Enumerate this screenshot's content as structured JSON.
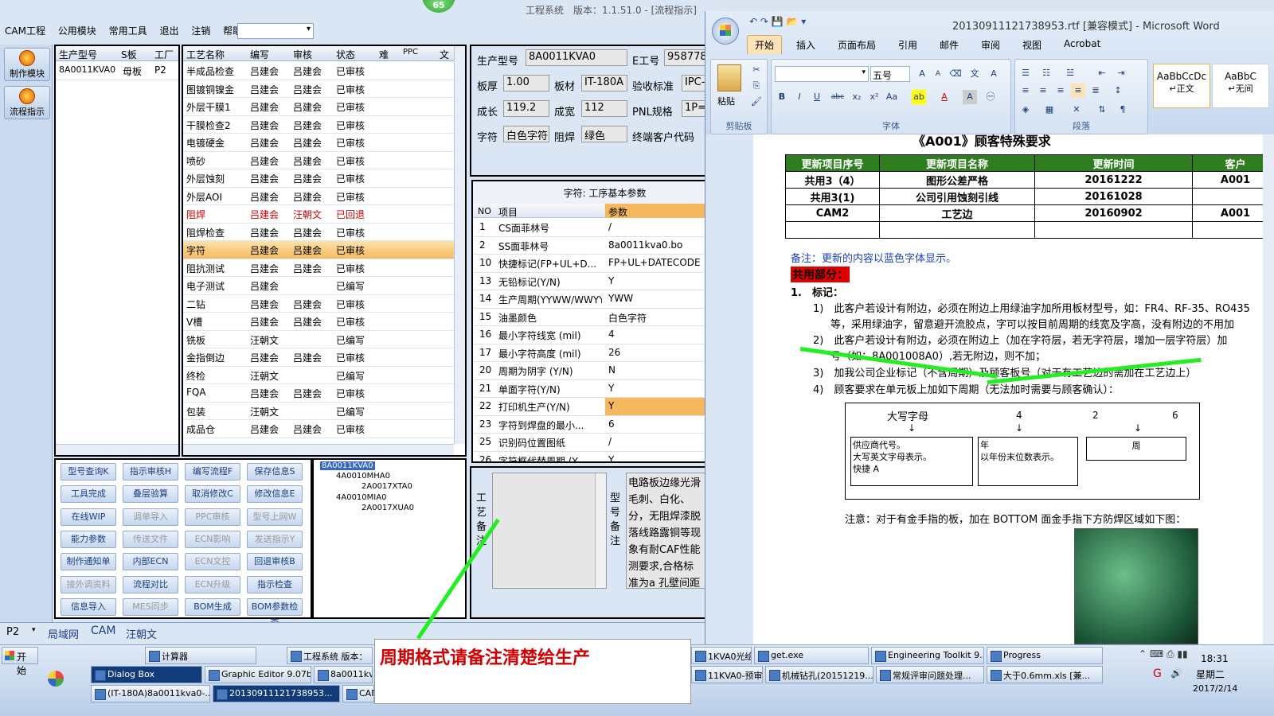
{
  "app": {
    "title": "工程系统　版本：1.1.51.0 - [流程指示]",
    "badge": "65",
    "menu": [
      "CAM工程",
      "公用模块",
      "常用工具",
      "退出",
      "注销",
      "帮助"
    ],
    "side_buttons": [
      "制作模块",
      "流程指示"
    ],
    "status_tabs": [
      "P2",
      "局域网",
      "CAM",
      "汪朝文"
    ]
  },
  "order_grid": {
    "headers": [
      "生产型号",
      "S板",
      "工厂"
    ],
    "rows": [
      [
        "8A0011KVA0",
        "母板",
        "P2"
      ]
    ]
  },
  "process_grid": {
    "headers": [
      "工艺名称",
      "编写",
      "审核",
      "状态",
      "难",
      "PPC",
      "文"
    ],
    "rows": [
      [
        "半成品检查",
        "吕建会",
        "吕建会",
        "已审核"
      ],
      [
        "图镀铜镍金",
        "吕建会",
        "吕建会",
        "已审核"
      ],
      [
        "外层干膜1",
        "吕建会",
        "吕建会",
        "已审核"
      ],
      [
        "干膜检查2",
        "吕建会",
        "吕建会",
        "已审核"
      ],
      [
        "电镀硬金",
        "吕建会",
        "吕建会",
        "已审核"
      ],
      [
        "喷砂",
        "吕建会",
        "吕建会",
        "已审核"
      ],
      [
        "外层蚀刻",
        "吕建会",
        "吕建会",
        "已审核"
      ],
      [
        "外层AOI",
        "吕建会",
        "吕建会",
        "已审核"
      ],
      [
        "阻焊",
        "吕建会",
        "汪朝文",
        "已回退"
      ],
      [
        "阻焊检查",
        "吕建会",
        "吕建会",
        "已审核"
      ],
      [
        "字符",
        "吕建会",
        "吕建会",
        "已审核"
      ],
      [
        "阻抗测试",
        "吕建会",
        "吕建会",
        "已审核"
      ],
      [
        "电子测试",
        "吕建会",
        "",
        "已编写"
      ],
      [
        "二钻",
        "吕建会",
        "吕建会",
        "已审核"
      ],
      [
        "V槽",
        "吕建会",
        "吕建会",
        "已审核"
      ],
      [
        "铣板",
        "汪朝文",
        "",
        "已编写"
      ],
      [
        "金指倒边",
        "吕建会",
        "吕建会",
        "已审核"
      ],
      [
        "终检",
        "汪朝文",
        "",
        "已编写"
      ],
      [
        "FQA",
        "吕建会",
        "吕建会",
        "已审核"
      ],
      [
        "包装",
        "汪朝文",
        "",
        "已编写"
      ],
      [
        "成品仓",
        "吕建会",
        "吕建会",
        "已审核"
      ]
    ],
    "selected_row": 10,
    "red_row": 8
  },
  "buttons": [
    [
      "型号查询K",
      "指示审核H",
      "编写流程F",
      "保存信息S"
    ],
    [
      "工具完成",
      "叠层验算",
      "取消修改C",
      "修改信息E"
    ],
    [
      "在线WIP",
      "调单导入",
      "PPC审核",
      "型号上网W"
    ],
    [
      "能力参数",
      "传送文件",
      "ECN影响",
      "发送指示Y"
    ],
    [
      "制作通知单",
      "内部ECN",
      "ECN文控",
      "回退审核B"
    ],
    [
      "接外调资料",
      "流程对比",
      "ECN升级",
      "指示检查"
    ],
    [
      "信息导入",
      "MES同步",
      "BOM生成",
      "BOM参数检查"
    ]
  ],
  "disabled_buttons": [
    "调单导入",
    "PPC审核",
    "型号上网W",
    "传送文件",
    "ECN影响",
    "发送指示Y",
    "ECN文控",
    "接外调资料",
    "ECN升级",
    "MES同步"
  ],
  "tree": [
    "8A0011KVA0",
    "4A0010MHA0",
    "2A0017XTA0",
    "4A0010MIA0",
    "2A0017XUA0"
  ],
  "info": {
    "labels": [
      "生产型号",
      "E工号",
      "板厚",
      "板材",
      "验收标准",
      "成长",
      "成宽",
      "PNL规格",
      "字符",
      "阻焊",
      "终端客户代码"
    ],
    "values": [
      "8A0011KVA0",
      "958778",
      "1.00",
      "IT-180A",
      "IPC-",
      "119.2",
      "112",
      "1P=",
      "白色字符",
      "绿色"
    ]
  },
  "params": {
    "caption": "字符: 工序基本参数",
    "headers": [
      "NO",
      "项目",
      "参数"
    ],
    "rows": [
      [
        "1",
        "CS面菲林号",
        "/"
      ],
      [
        "2",
        "SS面菲林号",
        "8a0011kva0.bo"
      ],
      [
        "10",
        "快捷标记(FP+UL+D...",
        "FP+UL+DATECODE"
      ],
      [
        "13",
        "无铅标记(Y/N)",
        "Y"
      ],
      [
        "14",
        "生产周期(YYWW/WWYY)",
        "YWW"
      ],
      [
        "15",
        "油墨颜色",
        "白色字符"
      ],
      [
        "16",
        "最小字符线宽 (mil)",
        "4"
      ],
      [
        "17",
        "最小字符高度 (mil)",
        "26"
      ],
      [
        "20",
        "周期为阴字 (Y/N)",
        "N"
      ],
      [
        "21",
        "单面字符(Y/N)",
        "Y"
      ],
      [
        "22",
        "打印机生产(Y/N)",
        "Y"
      ],
      [
        "23",
        "字符到焊盘的最小...",
        "6"
      ],
      [
        "25",
        "识别码位置图纸",
        "/"
      ],
      [
        "26",
        "字符框代替周期 (Y...",
        "Y"
      ]
    ],
    "selected_row": 10
  },
  "notes": {
    "label_left": "工艺备注",
    "label_right": "型号备注",
    "text": "电路板边缘光滑毛刺、白化、分，无阻焊漆脱落线路露铜等现象有耐CAF性能测要求,合格标准为a 孔壁间距"
  },
  "word": {
    "title": "20130911121738953.rtf [兼容模式] - Microsoft Word",
    "tabs": [
      "开始",
      "插入",
      "页面布局",
      "引用",
      "邮件",
      "审阅",
      "视图",
      "Acrobat"
    ],
    "groups": [
      "剪贴板",
      "字体",
      "段落"
    ],
    "paste": "粘贴",
    "font_size": "五号",
    "style1": "AaBbCcDc",
    "style1_name": "↵正文",
    "style2": "AaBbC",
    "style2_name": "↵无间",
    "heading": "《A001》顾客特殊要求",
    "table_headers": [
      "更新项目序号",
      "更新项目名称",
      "更新时间",
      "客户"
    ],
    "table_rows": [
      [
        "共用3（4）",
        "图形公差严格",
        "20161222",
        "A001"
      ],
      [
        "共用3(1)",
        "公司引用蚀刻引线",
        "20161028",
        ""
      ],
      [
        "CAM2",
        "工艺边",
        "20160902",
        "A001"
      ],
      [
        "",
        "",
        "",
        ""
      ]
    ],
    "note": "备注：更新的内容以蓝色字体显示。",
    "common": "共用部分：",
    "sec1": "1.　标记：",
    "items": [
      "1)　此客户若设计有附边，必须在附边上用绿油字加所用板材型号，如：FR4、RF-35、RO435",
      "等，采用绿油字，留意避开流胶点，字可以按目前周期的线宽及字高，没有附边的不用加",
      "2)　此客户若设计有附边，必须在附边上（加在字符层，若无字符层，增加一层字符层）加",
      "号（如：8A001008A0）,若无附边，则不加；",
      "3)　加我公司企业标记（不含周期）及顾客板号（对于有工艺边的需加在工艺边上）",
      "4)　顾客要求在单元板上加如下周期（无法加时需要与顾客确认）："
    ],
    "diagram": {
      "top": [
        "大写字母",
        "4",
        "2",
        "6"
      ],
      "box1": [
        "供应商代号。",
        "大写英文字母表示。",
        "快捷 A"
      ],
      "box2": [
        "年",
        "以年份末位数表示。"
      ],
      "box3": "周"
    },
    "note2": "注意：对于有金手指的板，加在 BOTTOM 面金手指下方防焊区域如下图："
  },
  "callout": "周期格式请备注清楚给生产",
  "taskbar": {
    "start": "开始",
    "row1": [
      "计算器",
      "工程系统 版本：",
      "1KVA0光绘...",
      "get.exe",
      "Engineering Toolkit 9....",
      "Progress"
    ],
    "row2": [
      "Dialog Box",
      "Graphic Editor 9.07b...",
      "8a0011kva",
      "11KVA0-预审指...",
      "机械钻孔(20151219...",
      "常规评审问题处理...",
      "大于0.6mm.xls [兼..."
    ],
    "row3": [
      "(IT-180A)8a0011kva0-...",
      "20130911121738953...",
      "CAM"
    ],
    "clock": {
      "time": "18:31",
      "day": "星期二",
      "date": "2017/2/14"
    }
  }
}
